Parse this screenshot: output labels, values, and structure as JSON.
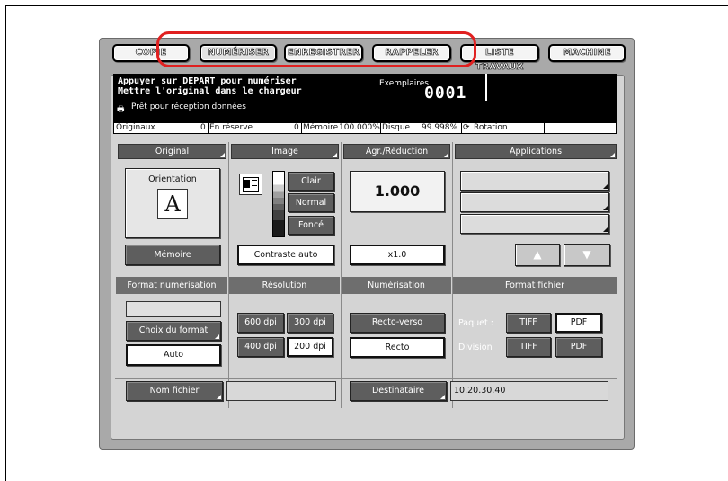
{
  "top_tabs": [
    "COPIE",
    "NUMÉRISER",
    "ENREGISTRER",
    "RAPPELER",
    "LISTE TRAVAUX",
    "MACHINE"
  ],
  "status": {
    "line1": "Appuyer sur DEPART pour numériser",
    "line2": "Mettre l'original dans le chargeur",
    "line3": "Prêt pour réception données",
    "printer_icon": "printer-icon",
    "copies_label": "Exemplaires",
    "copies_value": "0001"
  },
  "infobar": {
    "originals_label": "Originaux",
    "originals_value": "0",
    "reserve_label": "En réserve",
    "reserve_value": "0",
    "memory_label": "Mémoire",
    "memory_value": "100.000%",
    "disk_label": "Disque",
    "disk_value": "99.998%",
    "rotation_label": "Rotation"
  },
  "sections": {
    "original": "Original",
    "image": "Image",
    "zoom": "Agr./Réduction",
    "applications": "Applications",
    "scan_format": "Format numérisation",
    "resolution": "Résolution",
    "scanning": "Numérisation",
    "file_format": "Format fichier"
  },
  "original": {
    "orientation_label": "Orientation",
    "orientation_letter": "A",
    "memory_button": "Mémoire"
  },
  "image": {
    "light": "Clair",
    "normal": "Normal",
    "dark": "Foncé",
    "auto_contrast": "Contraste auto"
  },
  "zoom": {
    "value": "1.000",
    "x1": "x1.0"
  },
  "apps": {
    "up": "▲",
    "down": "▼"
  },
  "scan_format": {
    "choose": "Choix du format",
    "auto": "Auto"
  },
  "resolution": {
    "r600": "600 dpi",
    "r300": "300 dpi",
    "r400": "400 dpi",
    "r200": "200 dpi"
  },
  "scanning": {
    "duplex": "Recto-verso",
    "simplex": "Recto"
  },
  "file_format": {
    "batch_label": "Paquet :",
    "division_label": "Division",
    "tiff": "TIFF",
    "pdf": "PDF"
  },
  "bottom": {
    "filename_button": "Nom fichier",
    "recipient_button": "Destinataire",
    "recipient_value": "10.20.30.40"
  },
  "colors": {
    "highlight": "#e02020"
  }
}
